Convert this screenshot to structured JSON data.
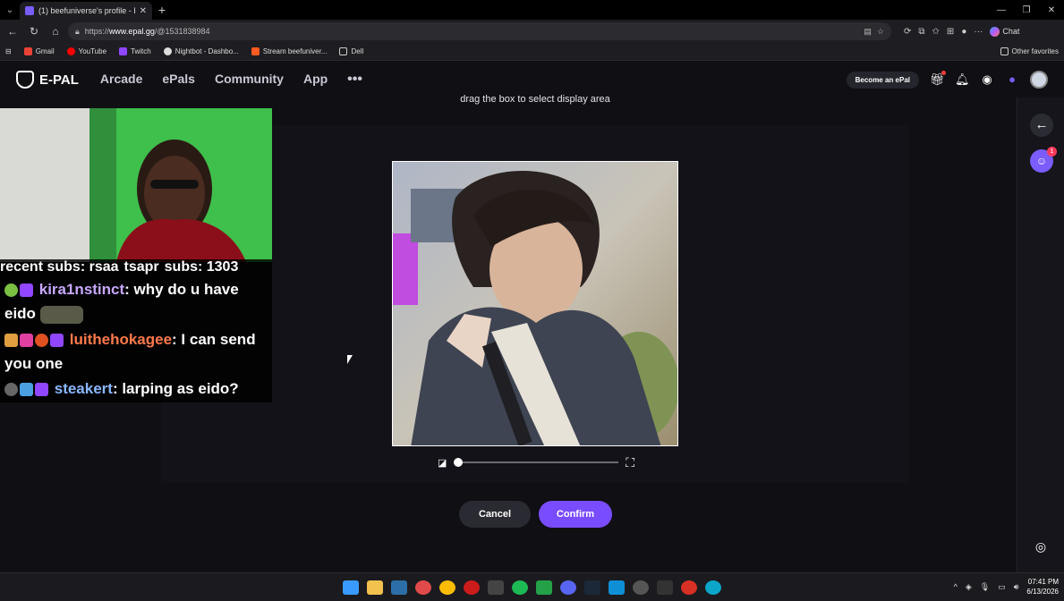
{
  "browser": {
    "tab_title": "(1) beefuniverse's profile - E-Pal",
    "new_tab": "+",
    "url_prefix": "https://",
    "url_domain": "www.epal.gg",
    "url_path": "/@1531838984",
    "copilot_label": "Chat",
    "bookmarks": [
      "Gmail",
      "YouTube",
      "Twitch",
      "Nightbot - Dashbo...",
      "Stream beefuniver...",
      "Dell"
    ],
    "other_favorites": "Other favorites"
  },
  "site": {
    "logo": "E-PAL",
    "nav": [
      "Arcade",
      "ePals",
      "Community",
      "App"
    ],
    "nav_more": "•••",
    "become_label": "Become an ePal"
  },
  "crop_modal": {
    "hint": "drag the box to select display area",
    "zoom_value": 0,
    "cancel_label": "Cancel",
    "confirm_label": "Confirm"
  },
  "right_rail": {
    "chat_badge": "1"
  },
  "stream_overlay": {
    "recent_subs": "recent subs: rsaa",
    "subs_mid": "tsapr",
    "subs_count": "subs: 1303",
    "chat": [
      {
        "user": "kira1nstinct",
        "user_color": "#c8a8ff",
        "message": ": why do u have eido"
      },
      {
        "user": "luithehokagee",
        "user_color": "#ff7a4a",
        "message": ": I can send you one"
      },
      {
        "user": "steakert",
        "user_color": "#8ab8ff",
        "message": ": larping as eido?"
      }
    ]
  },
  "taskbar": {
    "time": "07:41 PM",
    "date": "6/13/2026"
  }
}
